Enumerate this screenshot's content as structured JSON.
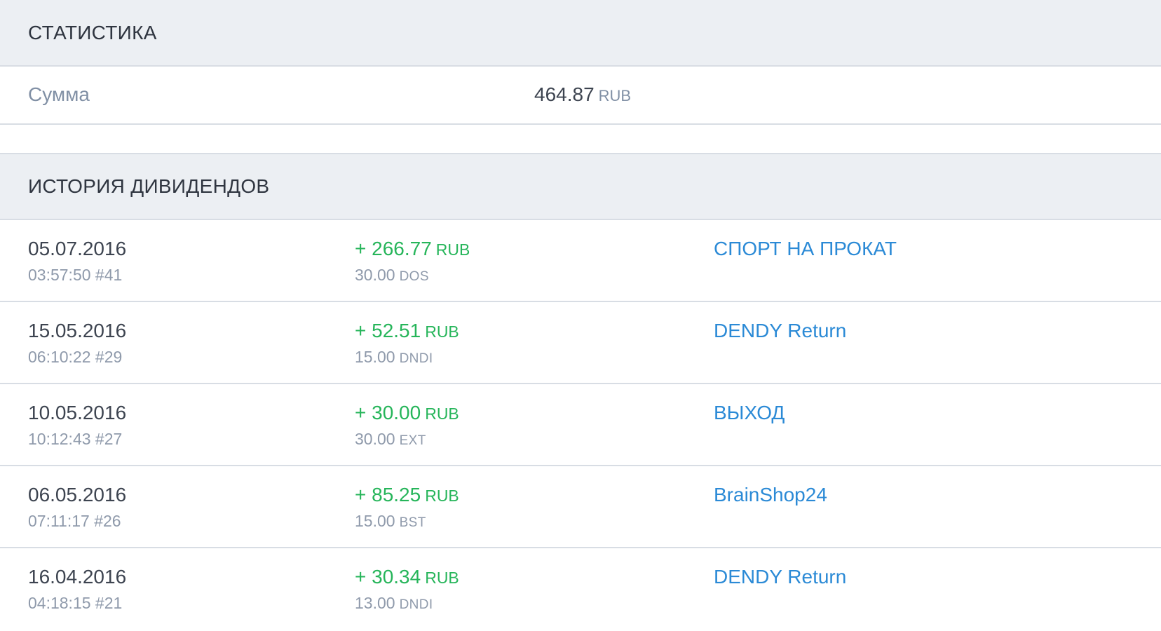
{
  "statistics": {
    "title": "СТАТИСТИКА",
    "sum_label": "Сумма",
    "sum_value": "464.87",
    "sum_currency": "RUB"
  },
  "history": {
    "title": "ИСТОРИЯ ДИВИДЕНДОВ",
    "rows": [
      {
        "date": "05.07.2016",
        "time_id": "03:57:50 #41",
        "amount": "+ 266.77",
        "currency": "RUB",
        "shares": "30.00",
        "ticker": "DOS",
        "project": "СПОРТ НА ПРОКАТ"
      },
      {
        "date": "15.05.2016",
        "time_id": "06:10:22 #29",
        "amount": "+ 52.51",
        "currency": "RUB",
        "shares": "15.00",
        "ticker": "DNDI",
        "project": "DENDY Return"
      },
      {
        "date": "10.05.2016",
        "time_id": "10:12:43 #27",
        "amount": "+ 30.00",
        "currency": "RUB",
        "shares": "30.00",
        "ticker": "EXT",
        "project": "ВЫХОД"
      },
      {
        "date": "06.05.2016",
        "time_id": "07:11:17 #26",
        "amount": "+ 85.25",
        "currency": "RUB",
        "shares": "15.00",
        "ticker": "BST",
        "project": "BrainShop24"
      },
      {
        "date": "16.04.2016",
        "time_id": "04:18:15 #21",
        "amount": "+ 30.34",
        "currency": "RUB",
        "shares": "13.00",
        "ticker": "DNDI",
        "project": "DENDY Return"
      }
    ]
  },
  "colors": {
    "header_bg": "#eceff3",
    "positive_amount": "#26b55a",
    "link": "#2b8ad6",
    "muted_text": "#8f9aab",
    "primary_text": "#3d4450"
  }
}
